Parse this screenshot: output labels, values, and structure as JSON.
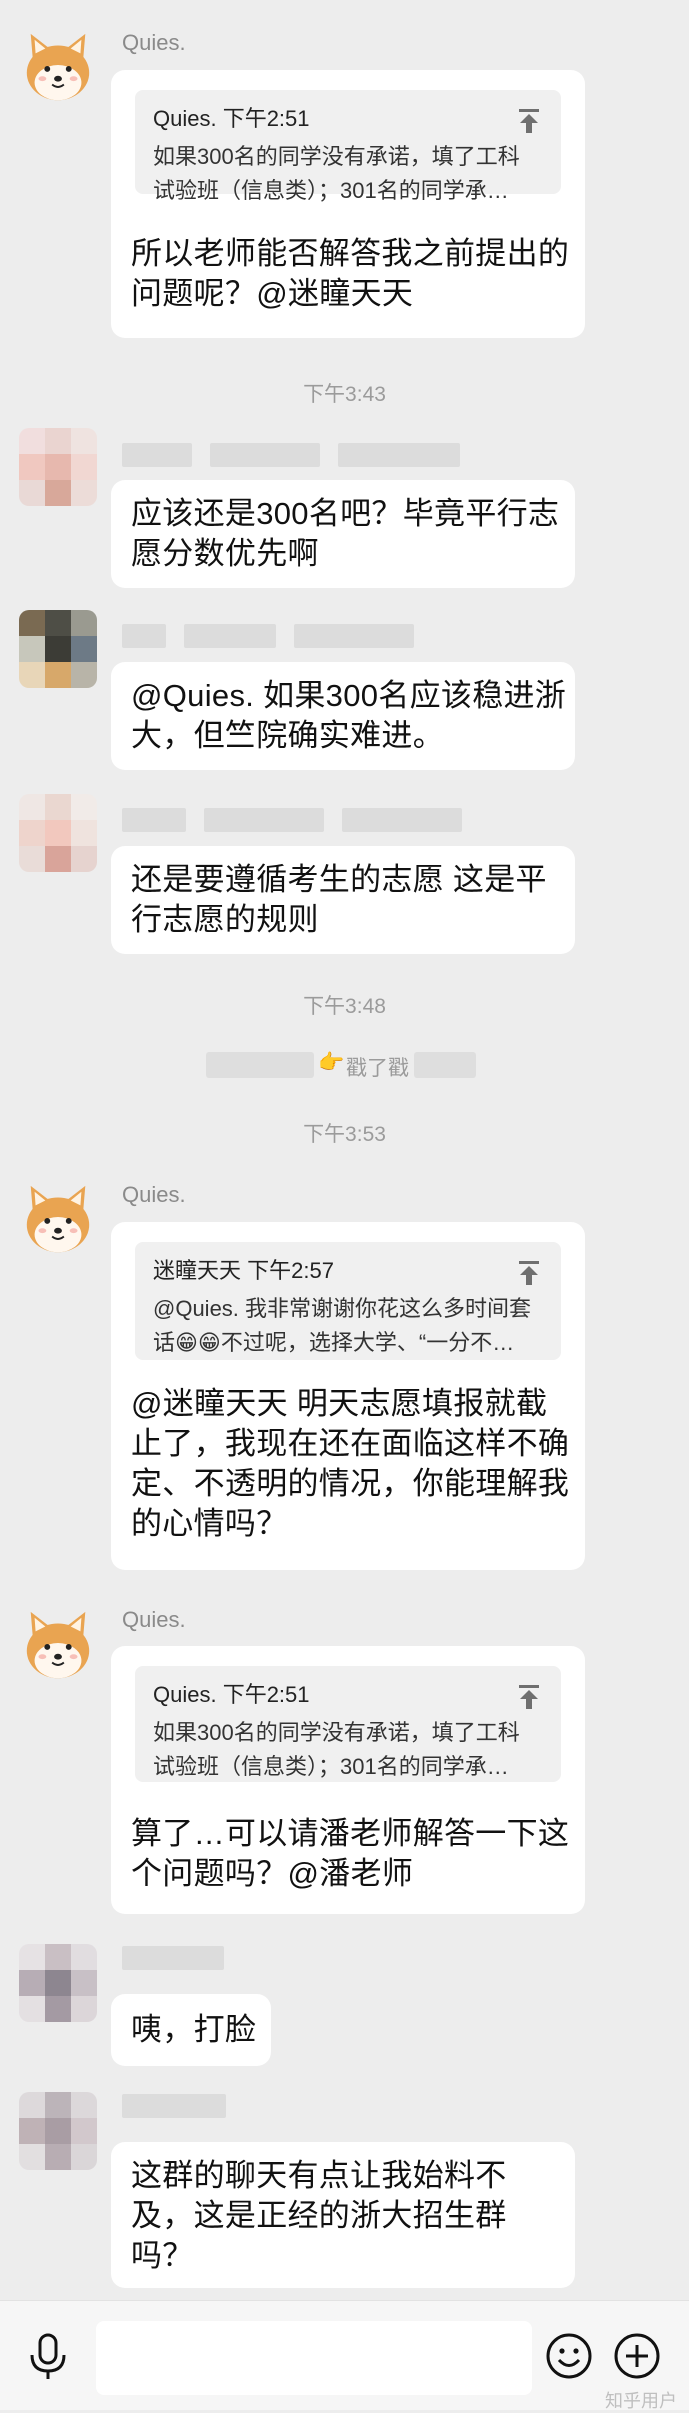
{
  "messages": {
    "m1": {
      "sender": "Quies.",
      "quote_head": "Quies. 下午2:51",
      "quote_line1": "如果300名的同学没有承诺，填了工科",
      "quote_line2": "试验班（信息类）；301名的同学承…",
      "line1": "所以老师能否解答我之前提出的",
      "line2": "问题呢？@迷瞳天天"
    },
    "t1": "下午3:43",
    "m2": {
      "line1": "应该还是300名吧？毕竟平行志",
      "line2": "愿分数优先啊"
    },
    "m3": {
      "line1": "@Quies. 如果300名应该稳进浙",
      "line2": "大，但竺院确实难进。"
    },
    "m4": {
      "line1": "还是要遵循考生的志愿 这是平",
      "line2": "行志愿的规则"
    },
    "t2": "下午3:48",
    "poke": {
      "text": "戳了戳",
      "emoji": "👉"
    },
    "t3": "下午3:53",
    "m5": {
      "sender": "Quies.",
      "quote_head": "迷瞳天天 下午2:57",
      "quote_line1": "@Quies. 我非常谢谢你花这么多时间套",
      "quote_line2": "话😁😁不过呢，选择大学、“一分不…",
      "line1": "@迷瞳天天 明天志愿填报就截",
      "line2": "止了，我现在还在面临这样不确",
      "line3": "定、不透明的情况，你能理解我",
      "line4": "的心情吗？"
    },
    "m6": {
      "sender": "Quies.",
      "quote_head": "Quies. 下午2:51",
      "quote_line1": "如果300名的同学没有承诺，填了工科",
      "quote_line2": "试验班（信息类）；301名的同学承…",
      "line1": "算了…可以请潘老师解答一下这",
      "line2": "个问题吗？@潘老师"
    },
    "m7": {
      "line1": "咦，打脸"
    },
    "m8": {
      "line1": "这群的聊天有点让我始料不",
      "line2": "及，这是正经的浙大招生群",
      "line3": "吗？"
    }
  },
  "bottom": {
    "voice_icon": "microphone-icon",
    "emoji_icon": "smiley-icon",
    "plus_icon": "plus-circle-icon",
    "input_value": ""
  },
  "watermark": "知乎用户",
  "colors": {
    "background": "#ededed",
    "bubble": "#ffffff",
    "quote": "#f0f0f0",
    "meta_text": "#9b9b9b"
  }
}
